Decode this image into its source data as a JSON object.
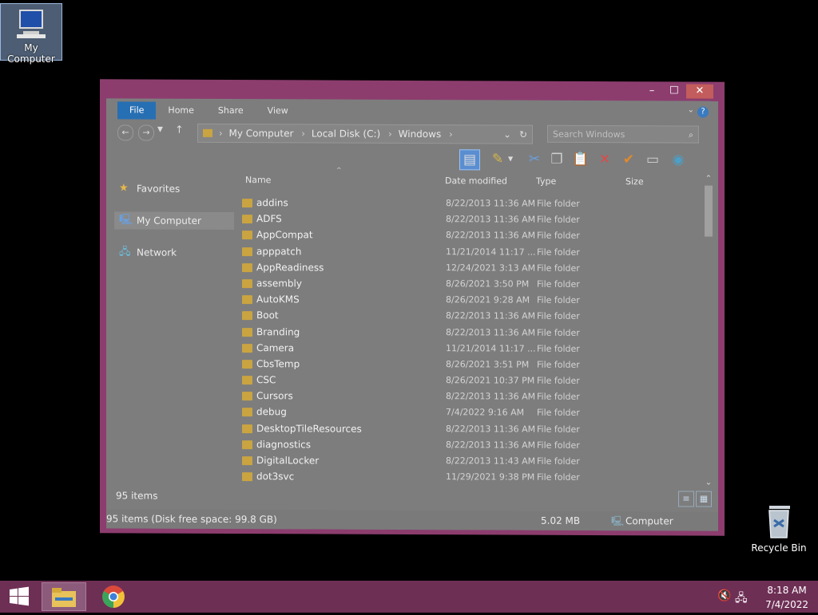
{
  "desktop": {
    "icons": [
      {
        "label": "My Computer",
        "icon": "my-computer-icon"
      },
      {
        "label": "Recycle Bin",
        "icon": "recycle-bin-icon"
      }
    ]
  },
  "window": {
    "ribbon_tabs": [
      "File",
      "Home",
      "Share",
      "View"
    ],
    "address": [
      "My Computer",
      "Local Disk (C:)",
      "Windows"
    ],
    "search_placeholder": "Search Windows",
    "columns": {
      "name": "Name",
      "date": "Date modified",
      "type": "Type",
      "size": "Size"
    },
    "nav": [
      "Favorites",
      "My Computer",
      "Network"
    ],
    "files": [
      {
        "name": "addins",
        "date": "8/22/2013 11:36 AM",
        "type": "File folder"
      },
      {
        "name": "ADFS",
        "date": "8/22/2013 11:36 AM",
        "type": "File folder"
      },
      {
        "name": "AppCompat",
        "date": "8/22/2013 11:36 AM",
        "type": "File folder"
      },
      {
        "name": "apppatch",
        "date": "11/21/2014 11:17 ...",
        "type": "File folder"
      },
      {
        "name": "AppReadiness",
        "date": "12/24/2021 3:13 AM",
        "type": "File folder"
      },
      {
        "name": "assembly",
        "date": "8/26/2021 3:50 PM",
        "type": "File folder"
      },
      {
        "name": "AutoKMS",
        "date": "8/26/2021 9:28 AM",
        "type": "File folder"
      },
      {
        "name": "Boot",
        "date": "8/22/2013 11:36 AM",
        "type": "File folder"
      },
      {
        "name": "Branding",
        "date": "8/22/2013 11:36 AM",
        "type": "File folder"
      },
      {
        "name": "Camera",
        "date": "11/21/2014 11:17 ...",
        "type": "File folder"
      },
      {
        "name": "CbsTemp",
        "date": "8/26/2021 3:51 PM",
        "type": "File folder"
      },
      {
        "name": "CSC",
        "date": "8/26/2021 10:37 PM",
        "type": "File folder"
      },
      {
        "name": "Cursors",
        "date": "8/22/2013 11:36 AM",
        "type": "File folder"
      },
      {
        "name": "debug",
        "date": "7/4/2022 9:16 AM",
        "type": "File folder"
      },
      {
        "name": "DesktopTileResources",
        "date": "8/22/2013 11:36 AM",
        "type": "File folder"
      },
      {
        "name": "diagnostics",
        "date": "8/22/2013 11:36 AM",
        "type": "File folder"
      },
      {
        "name": "DigitalLocker",
        "date": "8/22/2013 11:43 AM",
        "type": "File folder"
      },
      {
        "name": "dot3svc",
        "date": "11/29/2021 9:38 PM",
        "type": "File folder"
      }
    ],
    "status_items": "95 items",
    "status_bar": {
      "disk": "95 items (Disk free space: 99.8 GB)",
      "size": "5.02 MB",
      "location": "Computer"
    }
  },
  "taskbar": {
    "time": "8:18 AM",
    "date": "7/4/2022"
  }
}
